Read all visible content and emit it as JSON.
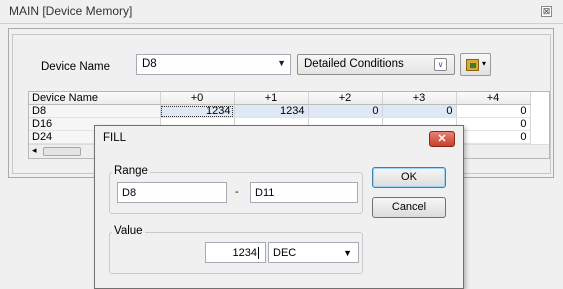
{
  "window": {
    "title": "MAIN [Device Memory]",
    "close_glyph": "⊠"
  },
  "toolbar": {
    "device_name_label": "Device Name",
    "device_name_value": "D8",
    "detailed_conditions_label": "Detailed Conditions",
    "dropdown_glyph": "▼",
    "expand_glyph": "∨",
    "tool_arrow_glyph": "▾"
  },
  "grid": {
    "columns": [
      "Device Name",
      "+0",
      "+1",
      "+2",
      "+3",
      "+4"
    ],
    "rows": [
      {
        "name": "D8",
        "values": [
          "1234",
          "1234",
          "0",
          "0",
          "0"
        ]
      },
      {
        "name": "D16",
        "values": [
          "",
          "",
          "",
          "",
          "0"
        ]
      },
      {
        "name": "D24",
        "values": [
          "",
          "",
          "",
          "",
          "0"
        ]
      }
    ],
    "scroll_up": "▲",
    "scroll_down": "▼",
    "scroll_left": "◂",
    "scroll_right": "▸"
  },
  "fill_dialog": {
    "title": "FILL",
    "close_glyph": "✕",
    "range_label": "Range",
    "range_from": "D8",
    "range_separator": "-",
    "range_to": "D11",
    "value_label": "Value",
    "value": "1234",
    "radix": "DEC",
    "radix_glyph": "▼",
    "ok_label": "OK",
    "cancel_label": "Cancel"
  }
}
